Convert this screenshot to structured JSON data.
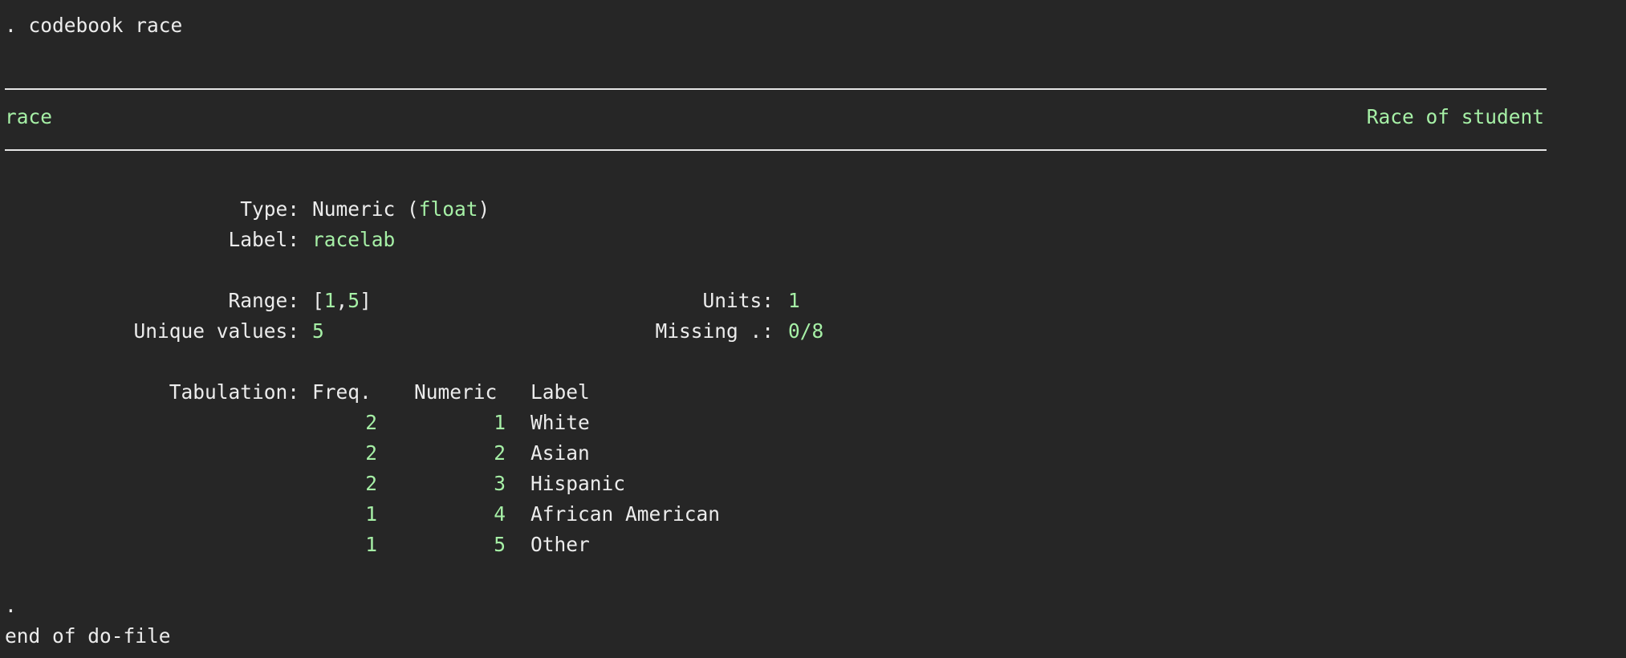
{
  "command": ". codebook race",
  "header": {
    "varname": "race",
    "varlabel": "Race of student"
  },
  "meta": {
    "type_label": "Type:",
    "type_value_prefix": "Numeric (",
    "type_value_storage": "float",
    "type_value_suffix": ")",
    "label_label": "Label:",
    "label_value": "racelab",
    "range_label": "Range:",
    "range_open": "[",
    "range_min": "1",
    "range_sep": ",",
    "range_max": "5",
    "range_close": "]",
    "units_label": "Units:",
    "units_value": "1",
    "unique_label": "Unique values:",
    "unique_value": "5",
    "missing_label": "Missing .:",
    "missing_value": "0/8"
  },
  "tabulation": {
    "label": "Tabulation:",
    "headers": {
      "freq": "Freq.",
      "numeric": "Numeric",
      "label": "Label"
    },
    "rows": [
      {
        "freq": "2",
        "numeric": "1",
        "label": "White"
      },
      {
        "freq": "2",
        "numeric": "2",
        "label": "Asian"
      },
      {
        "freq": "2",
        "numeric": "3",
        "label": "Hispanic"
      },
      {
        "freq": "1",
        "numeric": "4",
        "label": "African American"
      },
      {
        "freq": "1",
        "numeric": "5",
        "label": "Other"
      }
    ]
  },
  "footer": {
    "dot": ".",
    "end": "end of do-file"
  },
  "colors": {
    "background": "#262626",
    "text": "#ececec",
    "value_green": "#a6f0a6",
    "rule": "#e6e6e6"
  }
}
